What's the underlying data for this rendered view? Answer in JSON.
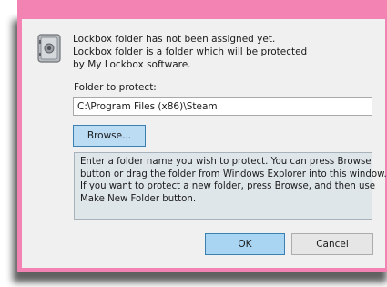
{
  "dialog": {
    "icon": "lockbox-safe-icon",
    "message": "Lockbox folder has not been assigned yet.\nLockbox folder is a folder which will be protected\nby My Lockbox software.",
    "folder_label": "Folder to protect:",
    "folder_value": "C:\\Program Files (x86)\\Steam",
    "browse_label": "Browse...",
    "info_text": "Enter a folder name you wish to protect. You can press Browse\nbutton or drag the folder from Windows Explorer into this window.\nIf you want to protect a new folder, press Browse, and then use\nMake New Folder button.",
    "ok_label": "OK",
    "cancel_label": "Cancel"
  },
  "colors": {
    "frame": "#f283b3",
    "dialog_bg": "#f0f0f0",
    "focused_button": "#a9d4f2",
    "info_bg": "#dfe6ea"
  }
}
